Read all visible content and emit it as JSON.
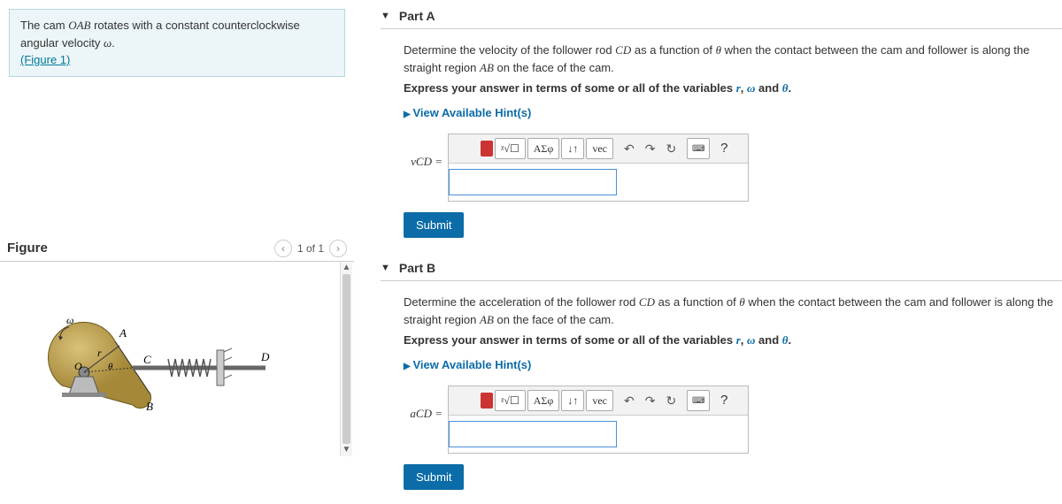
{
  "problem": {
    "text_prefix": "The cam ",
    "OAB": "OAB",
    "text_mid": " rotates with a constant counterclockwise angular velocity ",
    "omega": "ω",
    "text_suffix": ".",
    "figure_link": "(Figure 1)"
  },
  "figure": {
    "title": "Figure",
    "nav_prev": "‹",
    "nav_label": "1 of 1",
    "nav_next": "›",
    "labels": {
      "omega": "ω",
      "A": "A",
      "O": "O",
      "r": "r",
      "theta": "θ",
      "B": "B",
      "C": "C",
      "D": "D"
    }
  },
  "toolbar": {
    "sqrt": "ᵡ√☐",
    "greek": "ΑΣφ",
    "subsup": "↓↑",
    "vec": "vec",
    "undo": "↶",
    "redo": "↷",
    "reset": "↻",
    "keyboard": "⌨",
    "help": "?"
  },
  "partA": {
    "title": "Part A",
    "prompt_pre": "Determine the velocity of the follower rod ",
    "CD": "CD",
    "prompt_mid": " as a function of ",
    "theta": "θ",
    "prompt_post": " when the contact between the cam and follower is along the straight region ",
    "AB": "AB",
    "prompt_end": " on the face of the cam.",
    "express_pre": "Express your answer in terms of some or all of the variables ",
    "var_r": "r",
    "sep1": ", ",
    "var_w": "ω",
    "sep2": " and ",
    "var_th": "θ",
    "express_end": ".",
    "hints": "View Available Hint(s)",
    "label": "vCD =",
    "value": "",
    "submit": "Submit"
  },
  "partB": {
    "title": "Part B",
    "prompt_pre": "Determine the acceleration of the follower rod ",
    "CD": "CD",
    "prompt_mid": " as a function of ",
    "theta": "θ",
    "prompt_post": " when the contact between the cam and follower is along the straight region ",
    "AB": "AB",
    "prompt_end": " on the face of the cam.",
    "express_pre": "Express your answer in terms of some or all of the variables ",
    "var_r": "r",
    "sep1": ", ",
    "var_w": "ω",
    "sep2": " and ",
    "var_th": "θ",
    "express_end": ".",
    "hints": "View Available Hint(s)",
    "label": "aCD =",
    "value": "",
    "submit": "Submit"
  }
}
